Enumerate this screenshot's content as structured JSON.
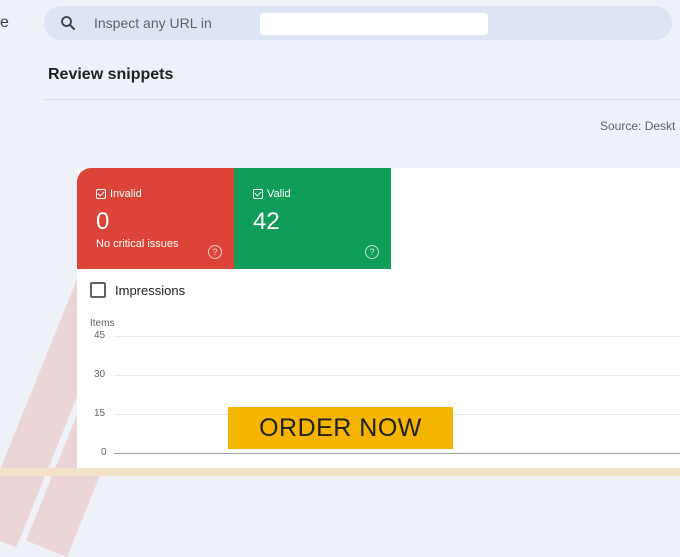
{
  "sidebar": {
    "letter": "e"
  },
  "search": {
    "placeholder": "Inspect any URL in"
  },
  "page": {
    "title": "Review snippets",
    "source_label": "Source: Deskt"
  },
  "cards": {
    "invalid": {
      "label": "Invalid",
      "value": "0",
      "subtext": "No critical issues",
      "color": "#db4437"
    },
    "valid": {
      "label": "Valid",
      "value": "42",
      "color": "#0f9d58"
    }
  },
  "impressions": {
    "label": "Impressions",
    "checked": false
  },
  "chart_data": {
    "type": "line",
    "ylabel": "Items",
    "yticks": [
      "45",
      "30",
      "15",
      "0"
    ],
    "ylim": [
      0,
      45
    ],
    "grid": true
  },
  "cta": {
    "label": "ORDER NOW",
    "color": "#f4b400"
  }
}
